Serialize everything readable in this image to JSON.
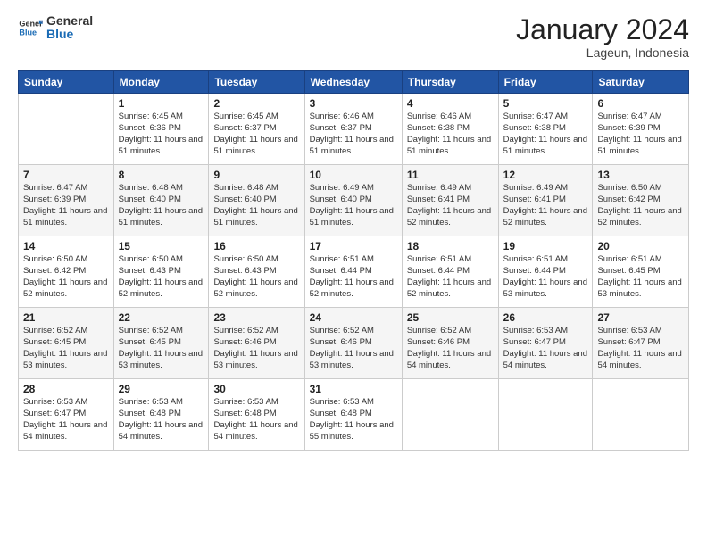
{
  "logo": {
    "line1": "General",
    "line2": "Blue"
  },
  "title": "January 2024",
  "location": "Lageun, Indonesia",
  "days_header": [
    "Sunday",
    "Monday",
    "Tuesday",
    "Wednesday",
    "Thursday",
    "Friday",
    "Saturday"
  ],
  "weeks": [
    [
      {
        "day": "",
        "sunrise": "",
        "sunset": "",
        "daylight": ""
      },
      {
        "day": "1",
        "sunrise": "Sunrise: 6:45 AM",
        "sunset": "Sunset: 6:36 PM",
        "daylight": "Daylight: 11 hours and 51 minutes."
      },
      {
        "day": "2",
        "sunrise": "Sunrise: 6:45 AM",
        "sunset": "Sunset: 6:37 PM",
        "daylight": "Daylight: 11 hours and 51 minutes."
      },
      {
        "day": "3",
        "sunrise": "Sunrise: 6:46 AM",
        "sunset": "Sunset: 6:37 PM",
        "daylight": "Daylight: 11 hours and 51 minutes."
      },
      {
        "day": "4",
        "sunrise": "Sunrise: 6:46 AM",
        "sunset": "Sunset: 6:38 PM",
        "daylight": "Daylight: 11 hours and 51 minutes."
      },
      {
        "day": "5",
        "sunrise": "Sunrise: 6:47 AM",
        "sunset": "Sunset: 6:38 PM",
        "daylight": "Daylight: 11 hours and 51 minutes."
      },
      {
        "day": "6",
        "sunrise": "Sunrise: 6:47 AM",
        "sunset": "Sunset: 6:39 PM",
        "daylight": "Daylight: 11 hours and 51 minutes."
      }
    ],
    [
      {
        "day": "7",
        "sunrise": "Sunrise: 6:47 AM",
        "sunset": "Sunset: 6:39 PM",
        "daylight": "Daylight: 11 hours and 51 minutes."
      },
      {
        "day": "8",
        "sunrise": "Sunrise: 6:48 AM",
        "sunset": "Sunset: 6:40 PM",
        "daylight": "Daylight: 11 hours and 51 minutes."
      },
      {
        "day": "9",
        "sunrise": "Sunrise: 6:48 AM",
        "sunset": "Sunset: 6:40 PM",
        "daylight": "Daylight: 11 hours and 51 minutes."
      },
      {
        "day": "10",
        "sunrise": "Sunrise: 6:49 AM",
        "sunset": "Sunset: 6:40 PM",
        "daylight": "Daylight: 11 hours and 51 minutes."
      },
      {
        "day": "11",
        "sunrise": "Sunrise: 6:49 AM",
        "sunset": "Sunset: 6:41 PM",
        "daylight": "Daylight: 11 hours and 52 minutes."
      },
      {
        "day": "12",
        "sunrise": "Sunrise: 6:49 AM",
        "sunset": "Sunset: 6:41 PM",
        "daylight": "Daylight: 11 hours and 52 minutes."
      },
      {
        "day": "13",
        "sunrise": "Sunrise: 6:50 AM",
        "sunset": "Sunset: 6:42 PM",
        "daylight": "Daylight: 11 hours and 52 minutes."
      }
    ],
    [
      {
        "day": "14",
        "sunrise": "Sunrise: 6:50 AM",
        "sunset": "Sunset: 6:42 PM",
        "daylight": "Daylight: 11 hours and 52 minutes."
      },
      {
        "day": "15",
        "sunrise": "Sunrise: 6:50 AM",
        "sunset": "Sunset: 6:43 PM",
        "daylight": "Daylight: 11 hours and 52 minutes."
      },
      {
        "day": "16",
        "sunrise": "Sunrise: 6:50 AM",
        "sunset": "Sunset: 6:43 PM",
        "daylight": "Daylight: 11 hours and 52 minutes."
      },
      {
        "day": "17",
        "sunrise": "Sunrise: 6:51 AM",
        "sunset": "Sunset: 6:44 PM",
        "daylight": "Daylight: 11 hours and 52 minutes."
      },
      {
        "day": "18",
        "sunrise": "Sunrise: 6:51 AM",
        "sunset": "Sunset: 6:44 PM",
        "daylight": "Daylight: 11 hours and 52 minutes."
      },
      {
        "day": "19",
        "sunrise": "Sunrise: 6:51 AM",
        "sunset": "Sunset: 6:44 PM",
        "daylight": "Daylight: 11 hours and 53 minutes."
      },
      {
        "day": "20",
        "sunrise": "Sunrise: 6:51 AM",
        "sunset": "Sunset: 6:45 PM",
        "daylight": "Daylight: 11 hours and 53 minutes."
      }
    ],
    [
      {
        "day": "21",
        "sunrise": "Sunrise: 6:52 AM",
        "sunset": "Sunset: 6:45 PM",
        "daylight": "Daylight: 11 hours and 53 minutes."
      },
      {
        "day": "22",
        "sunrise": "Sunrise: 6:52 AM",
        "sunset": "Sunset: 6:45 PM",
        "daylight": "Daylight: 11 hours and 53 minutes."
      },
      {
        "day": "23",
        "sunrise": "Sunrise: 6:52 AM",
        "sunset": "Sunset: 6:46 PM",
        "daylight": "Daylight: 11 hours and 53 minutes."
      },
      {
        "day": "24",
        "sunrise": "Sunrise: 6:52 AM",
        "sunset": "Sunset: 6:46 PM",
        "daylight": "Daylight: 11 hours and 53 minutes."
      },
      {
        "day": "25",
        "sunrise": "Sunrise: 6:52 AM",
        "sunset": "Sunset: 6:46 PM",
        "daylight": "Daylight: 11 hours and 54 minutes."
      },
      {
        "day": "26",
        "sunrise": "Sunrise: 6:53 AM",
        "sunset": "Sunset: 6:47 PM",
        "daylight": "Daylight: 11 hours and 54 minutes."
      },
      {
        "day": "27",
        "sunrise": "Sunrise: 6:53 AM",
        "sunset": "Sunset: 6:47 PM",
        "daylight": "Daylight: 11 hours and 54 minutes."
      }
    ],
    [
      {
        "day": "28",
        "sunrise": "Sunrise: 6:53 AM",
        "sunset": "Sunset: 6:47 PM",
        "daylight": "Daylight: 11 hours and 54 minutes."
      },
      {
        "day": "29",
        "sunrise": "Sunrise: 6:53 AM",
        "sunset": "Sunset: 6:48 PM",
        "daylight": "Daylight: 11 hours and 54 minutes."
      },
      {
        "day": "30",
        "sunrise": "Sunrise: 6:53 AM",
        "sunset": "Sunset: 6:48 PM",
        "daylight": "Daylight: 11 hours and 54 minutes."
      },
      {
        "day": "31",
        "sunrise": "Sunrise: 6:53 AM",
        "sunset": "Sunset: 6:48 PM",
        "daylight": "Daylight: 11 hours and 55 minutes."
      },
      {
        "day": "",
        "sunrise": "",
        "sunset": "",
        "daylight": ""
      },
      {
        "day": "",
        "sunrise": "",
        "sunset": "",
        "daylight": ""
      },
      {
        "day": "",
        "sunrise": "",
        "sunset": "",
        "daylight": ""
      }
    ]
  ]
}
